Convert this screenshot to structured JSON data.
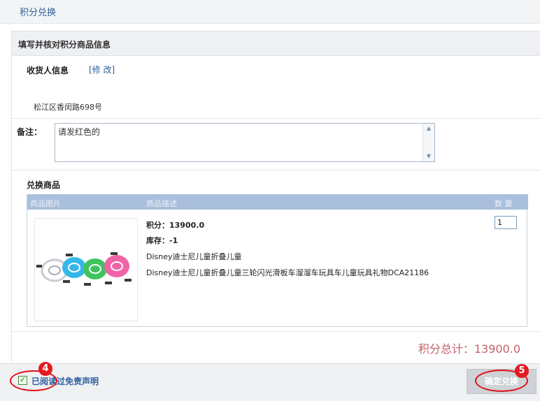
{
  "header": {
    "title": "积分兑换"
  },
  "panel": {
    "title": "填写并核对积分商品信息",
    "receiver": {
      "label": "收货人信息",
      "edit_link": "[修 改]",
      "address": "松江区香闵路698号"
    },
    "remark": {
      "label": "备注：",
      "value": "请发红色的"
    },
    "goods": {
      "label": "兑换商品",
      "columns": [
        "商品图片",
        "商品描述",
        "数 量"
      ],
      "item": {
        "points": "积分：13900.0",
        "stock": "库存：-1",
        "name": "Disney迪士尼儿童折叠儿童",
        "description": "Disney迪士尼儿童折叠儿童三轮闪光滑板车溜溜车玩具车儿童玩具礼物DCA21186",
        "quantity": "1",
        "image_icon": "usb-cables-product-image"
      }
    },
    "total": "积分总计：13900.0"
  },
  "footer": {
    "agree_label": "已阅读过免责声明",
    "agree_checked": true,
    "confirm_button": "确定兑换"
  },
  "annotations": [
    {
      "number": "4",
      "color": "#e31a1f"
    },
    {
      "number": "5",
      "color": "#e31a1f"
    }
  ]
}
